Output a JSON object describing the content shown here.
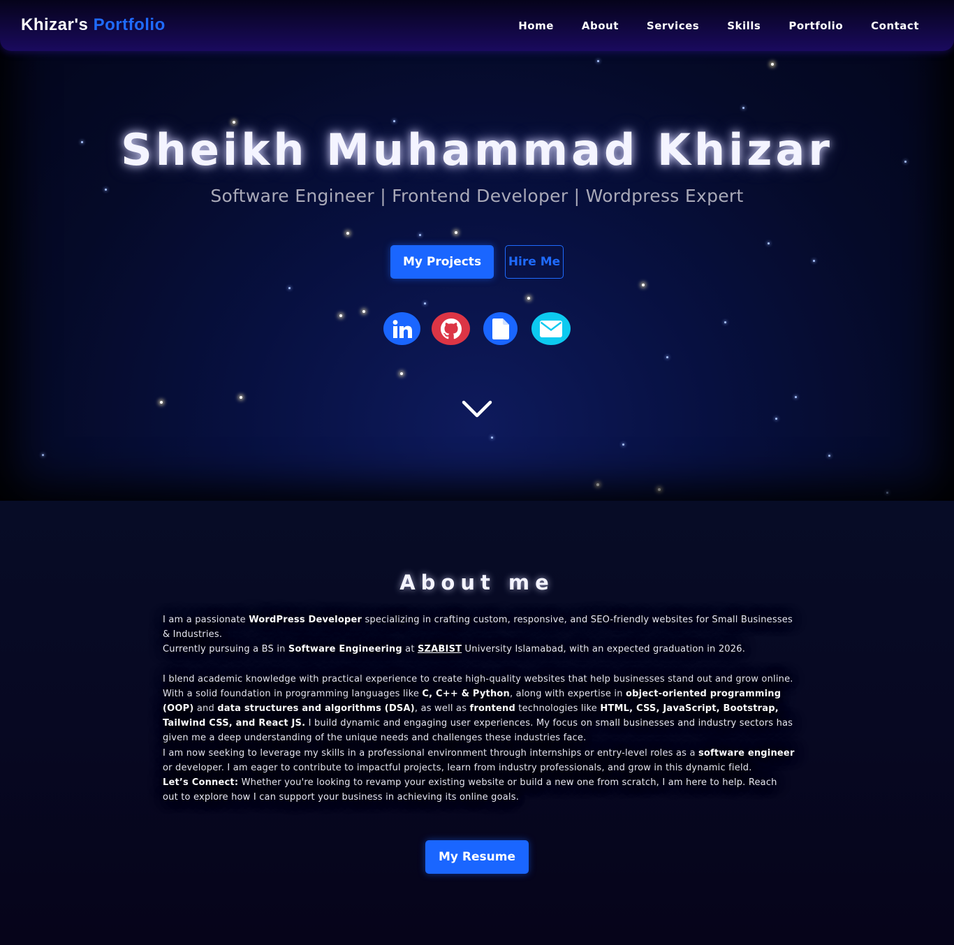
{
  "nav": {
    "brand_first": "Khizar's",
    "brand_accent": "Portfolio",
    "links": [
      "Home",
      "About",
      "Services",
      "Skills",
      "Portfolio",
      "Contact"
    ]
  },
  "hero": {
    "name": "Sheikh Muhammad Khizar",
    "subtitle": "Software Engineer | Frontend Developer | Wordpress Expert",
    "primary_button": "My Projects",
    "secondary_button": "Hire Me",
    "socials": [
      {
        "icon": "linkedin-icon",
        "color": "#1a66ff"
      },
      {
        "icon": "github-icon",
        "color": "#dc3545"
      },
      {
        "icon": "document-icon",
        "color": "#1a66ff"
      },
      {
        "icon": "envelope-icon",
        "color": "#0dcaf0"
      }
    ],
    "scroll_icon": "chevron-down-icon"
  },
  "about": {
    "title": "About me",
    "p1_a": "I am a passionate ",
    "p1_b": "WordPress Developer",
    "p1_c": " specializing in crafting custom, responsive, and SEO-friendly websites for Small Businesses & Industries.",
    "p2_a": "Currently pursuing a BS in ",
    "p2_b": "Software Engineering",
    "p2_c": " at ",
    "p2_link": "SZABIST",
    "p2_d": " University Islamabad, with an expected graduation in 2026.",
    "p3_a": "I blend academic knowledge with practical experience to create high-quality websites that help businesses stand out and grow online. With a solid foundation in programming languages like ",
    "p3_b": "C, C++ & Python",
    "p3_c": ", along with expertise in ",
    "p3_d": "object-oriented programming (OOP)",
    "p3_e": " and ",
    "p3_f": "data structures and algorithms (DSA)",
    "p3_g": ", as well as ",
    "p3_h": "frontend",
    "p3_i": " technologies like ",
    "p3_j": "HTML, CSS, JavaScript, Bootstrap, Tailwind CSS, and React JS.",
    "p3_k": " I build dynamic and engaging user experiences. My focus on small businesses and industry sectors has given me a deep understanding of the unique needs and challenges these industries face.",
    "p4_a": "I am now seeking to leverage my skills in a professional environment through internships or entry-level roles as a ",
    "p4_b": "software engineer",
    "p4_c": " or developer. I am eager to contribute to impactful projects, learn from industry professionals, and grow in this dynamic field.",
    "p5_a": "Let’s Connect:",
    "p5_b": " Whether you're looking to revamp your existing website or build a new one from scratch, I am here to help. Reach out to explore how I can support your business in achieving its online goals.",
    "resume_button": "My Resume"
  },
  "colors": {
    "accent": "#1a66ff",
    "navbar": "#1a0a5e",
    "background": "#070720"
  }
}
